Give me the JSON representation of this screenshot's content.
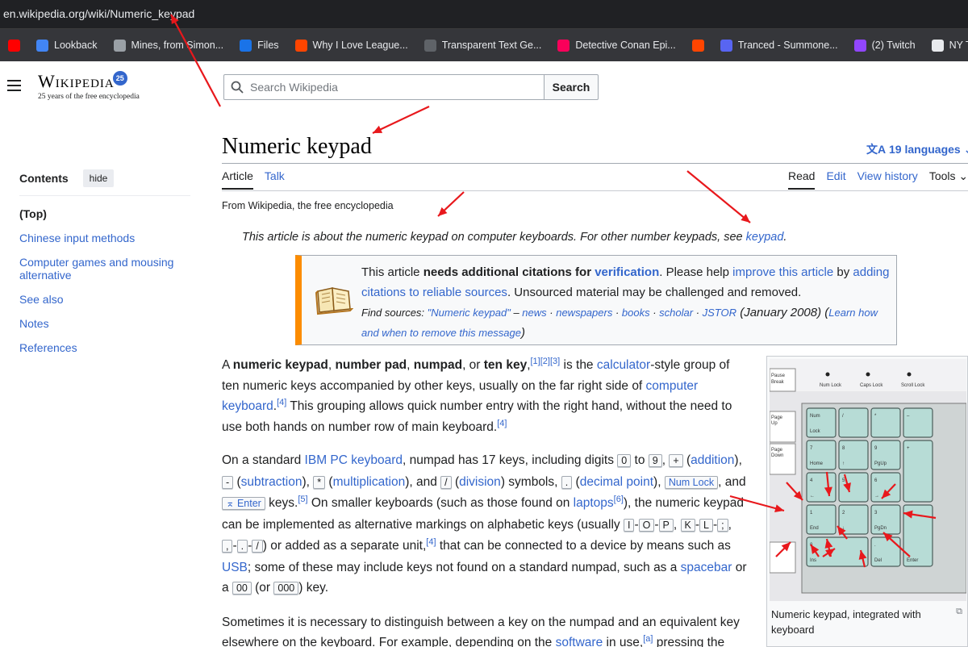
{
  "browser": {
    "url": "en.wikipedia.org/wiki/Numeric_keypad",
    "bookmarks": [
      {
        "label": "",
        "icon": "youtube-icon",
        "color": "#ff0000"
      },
      {
        "label": "Lookback",
        "icon": "search-icon",
        "color": "#4285f4"
      },
      {
        "label": "Mines, from Simon...",
        "icon": "globe-icon",
        "color": "#9aa0a6"
      },
      {
        "label": "Files",
        "icon": "files-icon",
        "color": "#1a73e8"
      },
      {
        "label": "Why I Love League...",
        "icon": "reddit-icon",
        "color": "#ff4500"
      },
      {
        "label": "Transparent Text Ge...",
        "icon": "spider-icon",
        "color": "#5f6368"
      },
      {
        "label": "Detective Conan Epi...",
        "icon": "fandom-icon",
        "color": "#fa005a"
      },
      {
        "label": "",
        "icon": "reddit-icon",
        "color": "#ff4500"
      },
      {
        "label": "Tranced - Summone...",
        "icon": "discord-icon",
        "color": "#5865f2"
      },
      {
        "label": "(2) Twitch",
        "icon": "twitch-icon",
        "color": "#9146ff"
      },
      {
        "label": "NY Times, Saturday,...",
        "icon": "page-icon",
        "color": "#e8eaed"
      }
    ]
  },
  "header": {
    "logo_word": "Wikipedia",
    "logo_badge": "25",
    "tagline": "25 years of the free encyclopedia",
    "search_placeholder": "Search Wikipedia",
    "search_button": "Search"
  },
  "toc": {
    "title": "Contents",
    "hide": "hide",
    "items": [
      "(Top)",
      "Chinese input methods",
      "Computer games and mousing alternative",
      "See also",
      "Notes",
      "References"
    ]
  },
  "article": {
    "title": "Numeric keypad",
    "languages": "19 languages",
    "tabs_left": [
      "Article",
      "Talk"
    ],
    "tabs_right": [
      "Read",
      "Edit",
      "View history",
      "Tools"
    ],
    "from": "From Wikipedia, the free encyclopedia",
    "hatnote": "This article is about the numeric keypad on computer keyboards. For other number keypads, see",
    "hatnote_link": "keypad",
    "ambox": {
      "t1": "This article ",
      "t2": "needs additional citations for ",
      "t3": "verification",
      "t4": ". Please help ",
      "t5": "improve this article",
      "t6": " by ",
      "t7": "adding citations to reliable sources",
      "t8": ". Unsourced material may be challenged and removed.",
      "find": "Find sources:",
      "q": "\"Numeric keypad\"",
      "dash": " – ",
      "s1": "news",
      "s2": "newspapers",
      "s3": "books",
      "s4": "scholar",
      "s5": "JSTOR",
      "date": "(January 2008)",
      "learn": "Learn how and when to remove this message"
    },
    "figure_caption": "Numeric keypad, integrated with keyboard"
  },
  "keyboard_image": {
    "top_labels": [
      "Pause Break",
      "Num Lock",
      "Caps Lock",
      "Scroll Lock"
    ],
    "keys": [
      "Num Lock",
      "/",
      "*",
      "–",
      "7 Home",
      "8 ↑",
      "9 PgUp",
      "+",
      "4 ←",
      "5",
      "6 →",
      "1 End",
      "2 ↓",
      "3 PgDn",
      "Enter",
      "0 Ins",
      ". Del"
    ],
    "side_keys": [
      "Page Up",
      "Page Down"
    ]
  }
}
